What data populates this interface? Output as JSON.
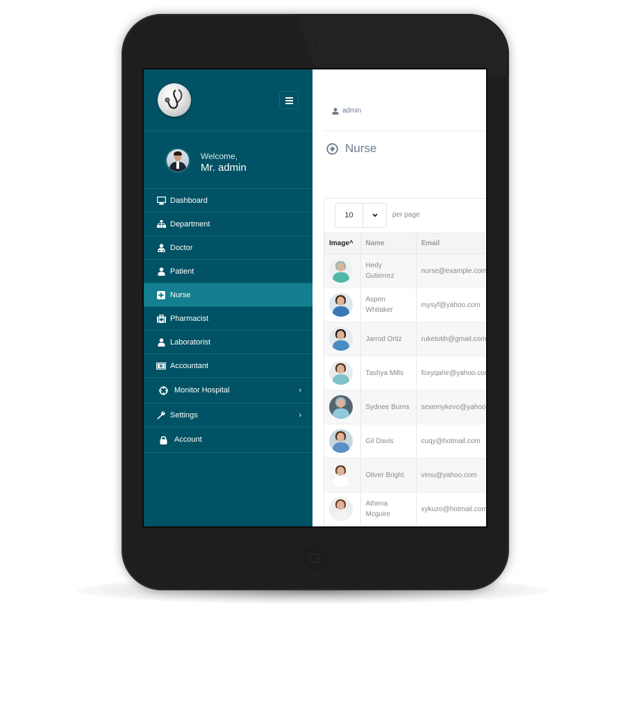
{
  "app": {
    "sidebar": {
      "welcome_label": "Welcome,",
      "user_name": "Mr. admin",
      "items": [
        {
          "label": "Dashboard",
          "icon": "desktop-icon",
          "active": false,
          "has_submenu": false
        },
        {
          "label": "Department",
          "icon": "sitemap-icon",
          "active": false,
          "has_submenu": false
        },
        {
          "label": "Doctor",
          "icon": "user-doctor-icon",
          "active": false,
          "has_submenu": false
        },
        {
          "label": "Patient",
          "icon": "user-icon",
          "active": false,
          "has_submenu": false
        },
        {
          "label": "Nurse",
          "icon": "plus-square-icon",
          "active": true,
          "has_submenu": false
        },
        {
          "label": "Pharmacist",
          "icon": "medkit-icon",
          "active": false,
          "has_submenu": false
        },
        {
          "label": "Laboratorist",
          "icon": "user-icon",
          "active": false,
          "has_submenu": false
        },
        {
          "label": "Accountant",
          "icon": "money-icon",
          "active": false,
          "has_submenu": false
        },
        {
          "label": "Monitor Hospital",
          "icon": "crosshairs-icon",
          "active": false,
          "has_submenu": true
        },
        {
          "label": "Settings",
          "icon": "wrench-icon",
          "active": false,
          "has_submenu": true
        },
        {
          "label": "Account",
          "icon": "lock-icon",
          "active": false,
          "has_submenu": false
        }
      ],
      "chevron": "›"
    },
    "topbar": {
      "user_link": "admin"
    },
    "page": {
      "title": "Nurse"
    },
    "table": {
      "per_page_value": "10",
      "per_page_label": "per page",
      "columns": [
        "Image^",
        "Name",
        "Email"
      ],
      "sorted_column": "Image",
      "rows": [
        {
          "name": "Hedy Gutierrez",
          "email": "nurse@example.com",
          "photo": {
            "bg": "#eef1f2",
            "hair": "#8fb9b4",
            "body": "#4fb8a8"
          }
        },
        {
          "name": "Aspen Whitaker",
          "email": "mysyf@yahoo.com",
          "photo": {
            "bg": "#dfe7ee",
            "hair": "#3a2418",
            "body": "#3b78b8"
          }
        },
        {
          "name": "Jarrod Ortiz",
          "email": "ruketotih@gmail.com",
          "photo": {
            "bg": "#e6e9ec",
            "hair": "#1a1210",
            "body": "#4a8cc4"
          }
        },
        {
          "name": "Tashya Mills",
          "email": "foxyqahir@yahoo.com",
          "photo": {
            "bg": "#e9ecee",
            "hair": "#4a2e1e",
            "body": "#7fc1c8"
          }
        },
        {
          "name": "Sydnee Burns",
          "email": "sexemykevo@yahoo.com",
          "photo": {
            "bg": "#556670",
            "hair": "#8fb7cf",
            "body": "#8fc9dc"
          }
        },
        {
          "name": "Gil Davis",
          "email": "cuqy@hotmail.com",
          "photo": {
            "bg": "#c7d6df",
            "hair": "#4a2a1a",
            "body": "#5b8fc9"
          }
        },
        {
          "name": "Oliver Bright",
          "email": "vimu@yahoo.com",
          "photo": {
            "bg": "#f5f5f5",
            "hair": "#5a3a26",
            "body": "#ffffff"
          }
        },
        {
          "name": "Athena Mcguire",
          "email": "xykuzo@hotmail.com",
          "photo": {
            "bg": "#eeeeee",
            "hair": "#6a3f26",
            "body": "#f2f2f2"
          }
        }
      ]
    },
    "colors": {
      "sidebar_bg": "#005264",
      "sidebar_active": "#137f8f",
      "title_text": "#6b7a8f"
    }
  }
}
